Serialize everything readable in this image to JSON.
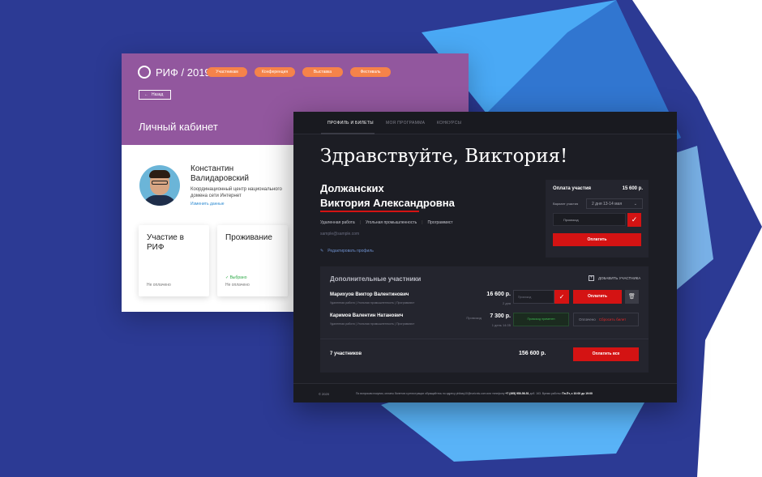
{
  "colors": {
    "accent": "#d41313",
    "purple": "#92579e",
    "orange": "#f5834a",
    "dark": "#1c1d24",
    "blue": "#2c3a94"
  },
  "left": {
    "logo": "РИФ / 2019",
    "nav": [
      "Участникам",
      "Конференция",
      "Выставка",
      "Фестиваль"
    ],
    "back": "Назад",
    "title": "Личный кабинет",
    "person": {
      "name": "Константин Валидаровский",
      "org": "Координационный центр национального домена сети Интернет",
      "edit": "Изменить данные"
    },
    "cards": [
      {
        "title": "Участие в РИФ",
        "selected": "",
        "status": "Не оплачено"
      },
      {
        "title": "Проживание",
        "selected": "✓ Выбрано",
        "status": "Не оплачено"
      }
    ]
  },
  "right": {
    "tabs": [
      "ПРОФИЛЬ И БИЛЕТЫ",
      "МОЯ ПРОГРАММА",
      "КОНКУРСЫ"
    ],
    "greeting": "Здравствуйте, Виктория!",
    "fio1": "Должанских",
    "fio2": "Виктория Александровна",
    "tags": [
      "Удаленная работа",
      "Угольная промышленность",
      "Программист"
    ],
    "email": "sample@sample.com",
    "edit_profile": "Редактировать профиль",
    "payment": {
      "label": "Оплата участия",
      "sum": "15 600 р.",
      "variant_label": "Вариант участия",
      "variant_value": "2 дня 13-14 мая",
      "promo_placeholder": "Промокод",
      "pay": "Оплатить"
    },
    "extra": {
      "title": "Дополнительные участники",
      "add": "ДОБАВИТЬ УЧАСТНИКА",
      "participants": [
        {
          "name": "Марихуов Виктор Валентинович",
          "tags": "Удаленная работа  |  Угольная промышленность  |  Программист",
          "price": "16 600 р.",
          "sub": "2 дня",
          "promo": "Промокод",
          "pay": "Оплатить"
        },
        {
          "name": "Каримов Валентин Натанович",
          "tags": "Удаленная работа  |  Угольная промышленность  |  Программист",
          "price": "7 300 р.",
          "sub": "1 день 14.05",
          "note": "Промокод",
          "promo_applied": "Промокод применен",
          "paid": "Оплачено",
          "cancel": "Сбросить билет"
        }
      ],
      "total_count": "7 участников",
      "total_sum": "156 600 р.",
      "pay_all": "Оплатить все"
    },
    "footer": {
      "copy": "© 2020",
      "text": "По вопросам покупки, оплаты билетов и регистрации обращайтесь по адресу philasy10@runicnis.com или телефону",
      "phone": "+7 (495) 950-56-51",
      "ext": " доб. 163. Время работы:",
      "hours": "Пн-Пт, с 10:00 до 19:00"
    }
  }
}
